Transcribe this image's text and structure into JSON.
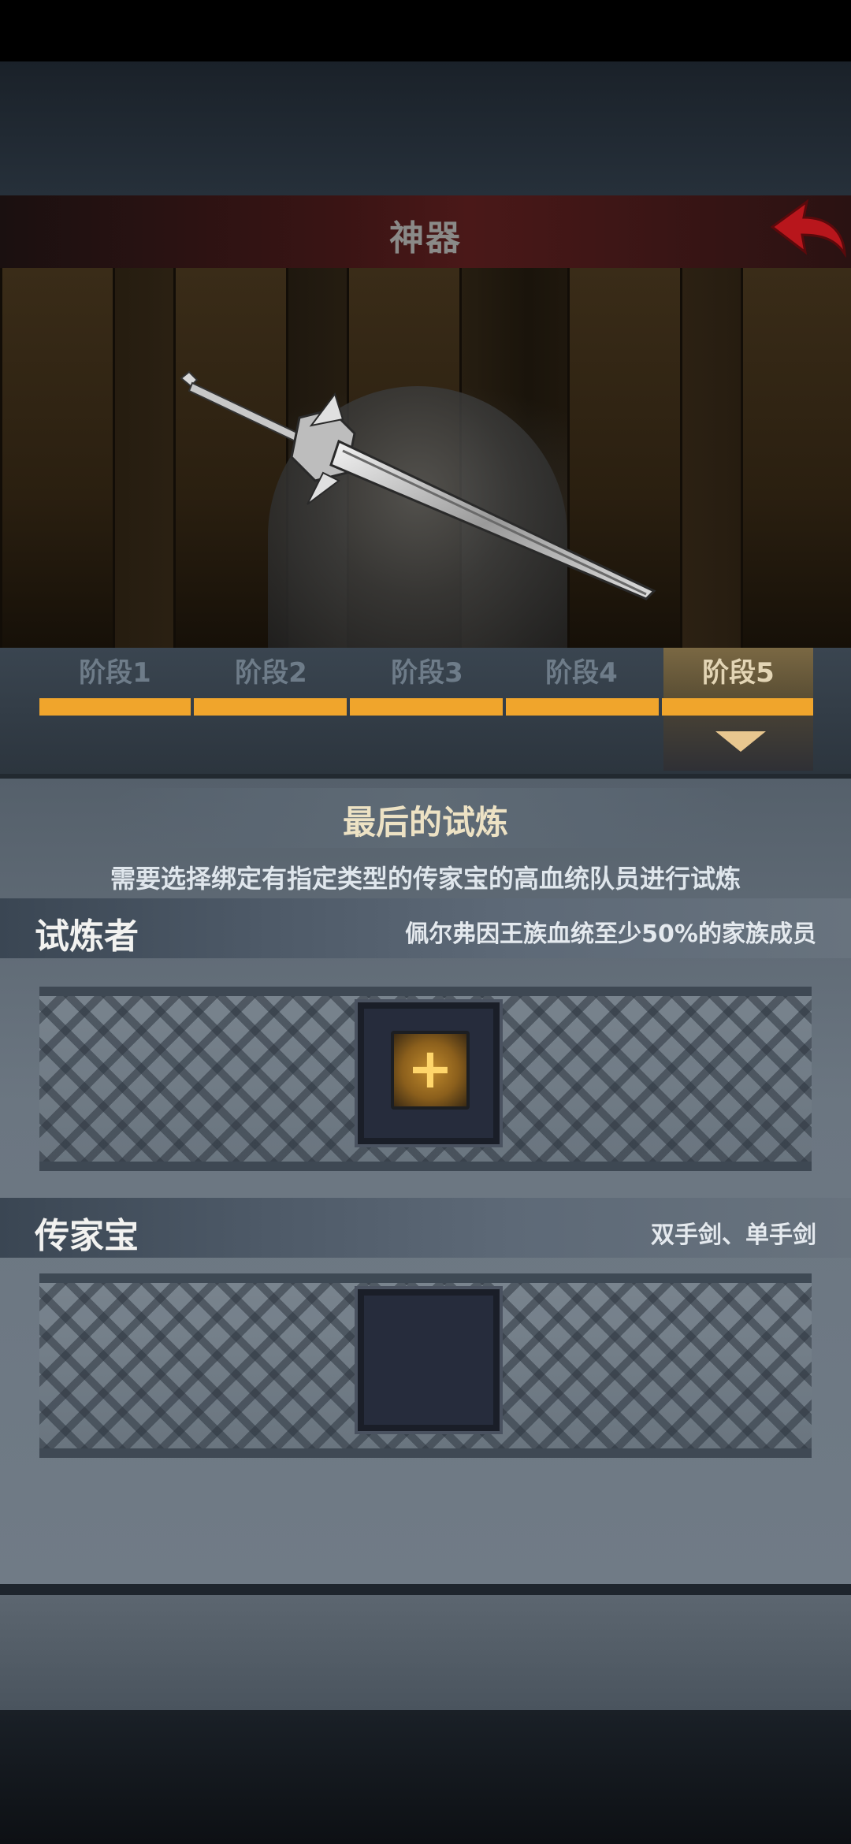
{
  "header": {
    "title": "神器",
    "back_icon": "back-arrow-icon"
  },
  "stages": {
    "tabs": [
      {
        "label": "阶段1"
      },
      {
        "label": "阶段2"
      },
      {
        "label": "阶段3"
      },
      {
        "label": "阶段4"
      },
      {
        "label": "阶段5"
      }
    ],
    "active_index": 4,
    "progress_color": "#f0a52c"
  },
  "trial": {
    "title": "最后的试炼",
    "description": "需要选择绑定有指定类型的传家宝的高血统队员进行试炼"
  },
  "challenger": {
    "label": "试炼者",
    "requirement": "佩尔弗因王族血统至少50%的家族成员",
    "add_icon": "plus-icon"
  },
  "heirloom": {
    "label": "传家宝",
    "requirement": "双手剑、单手剑"
  },
  "colors": {
    "accent": "#f0a52c",
    "title_red": "#4a1818",
    "panel": "#6b7681"
  }
}
